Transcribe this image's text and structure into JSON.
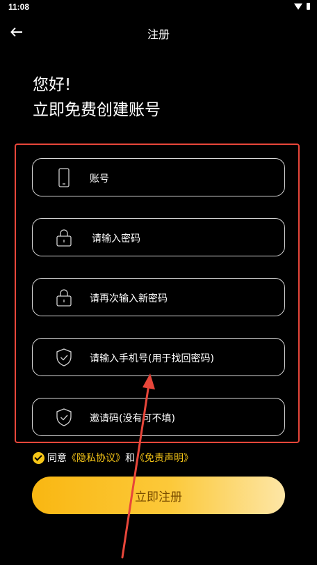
{
  "status_bar": {
    "time": "11:08"
  },
  "header": {
    "title": "注册"
  },
  "greeting": {
    "line1": "您好!",
    "line2": "立即免费创建账号"
  },
  "form": {
    "fields": [
      {
        "label": "账号",
        "icon": "phone-icon"
      },
      {
        "label": "请输入密码",
        "icon": "lock-icon"
      },
      {
        "label": "请再次输入新密码",
        "icon": "lock-icon"
      },
      {
        "label": "请输入手机号(用于找回密码)",
        "icon": "shield-check-icon"
      },
      {
        "label": "邀请码(没有可不填)",
        "icon": "shield-check-icon"
      }
    ]
  },
  "agreement": {
    "prefix": "同意",
    "privacy_link": "《隐私协议》",
    "conjunction": "和",
    "disclaimer_link": "《免责声明》"
  },
  "submit": {
    "label": "立即注册"
  },
  "colors": {
    "accent": "#f6c617",
    "annotation": "#e8463a",
    "background": "#000000"
  }
}
